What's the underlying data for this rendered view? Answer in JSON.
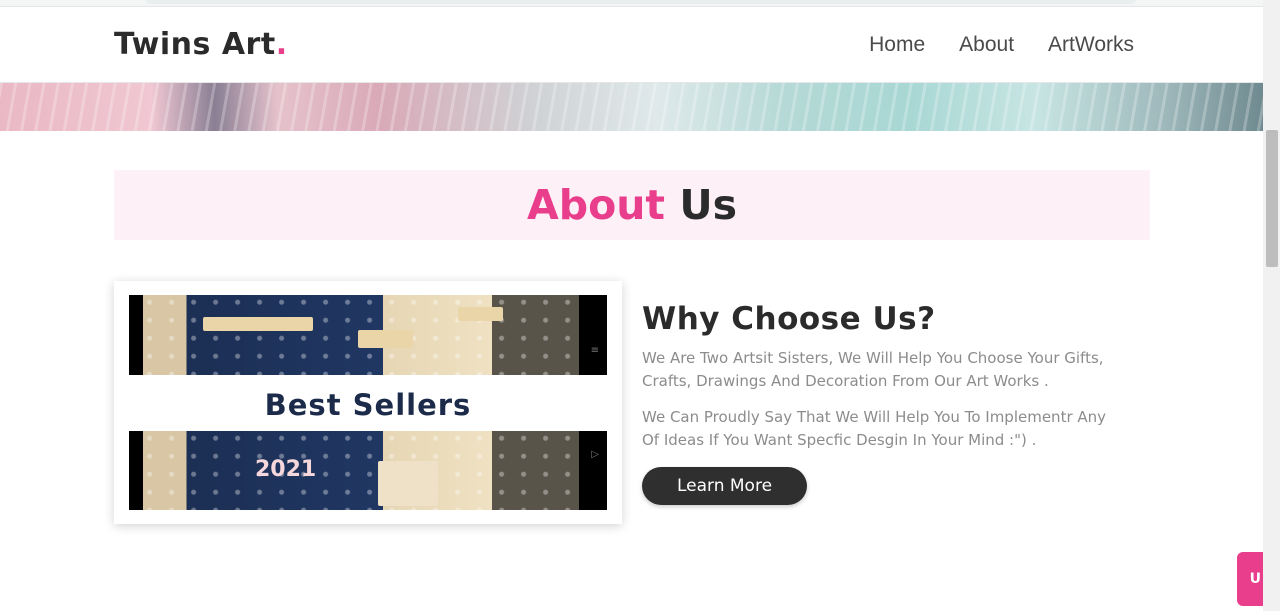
{
  "header": {
    "brand_text": "Twins Art",
    "brand_dot": ".",
    "nav": [
      "Home",
      "About",
      "ArtWorks"
    ]
  },
  "about": {
    "title_highlight": "About",
    "title_rest": "Us"
  },
  "media": {
    "overlay_text": "Best Sellers",
    "year_text": "2021"
  },
  "content": {
    "heading": "Why Choose Us?",
    "paragraph_1": "We Are Two Artsit Sisters, We Will Help You Choose Your Gifts, Crafts, Drawings And Decoration From Our Art Works .",
    "paragraph_2": "We Can Proudly Say That We Will Help You To Implementr Any Of Ideas If You Want Specfic Desgin In Your Mind :\") .",
    "button_label": "Learn More"
  },
  "floating_button": {
    "label": "U"
  },
  "colors": {
    "accent": "#e83e8c",
    "dark": "#2b2b2b",
    "title_bg": "#fdf0f6",
    "muted_text": "#8c8c8c"
  }
}
